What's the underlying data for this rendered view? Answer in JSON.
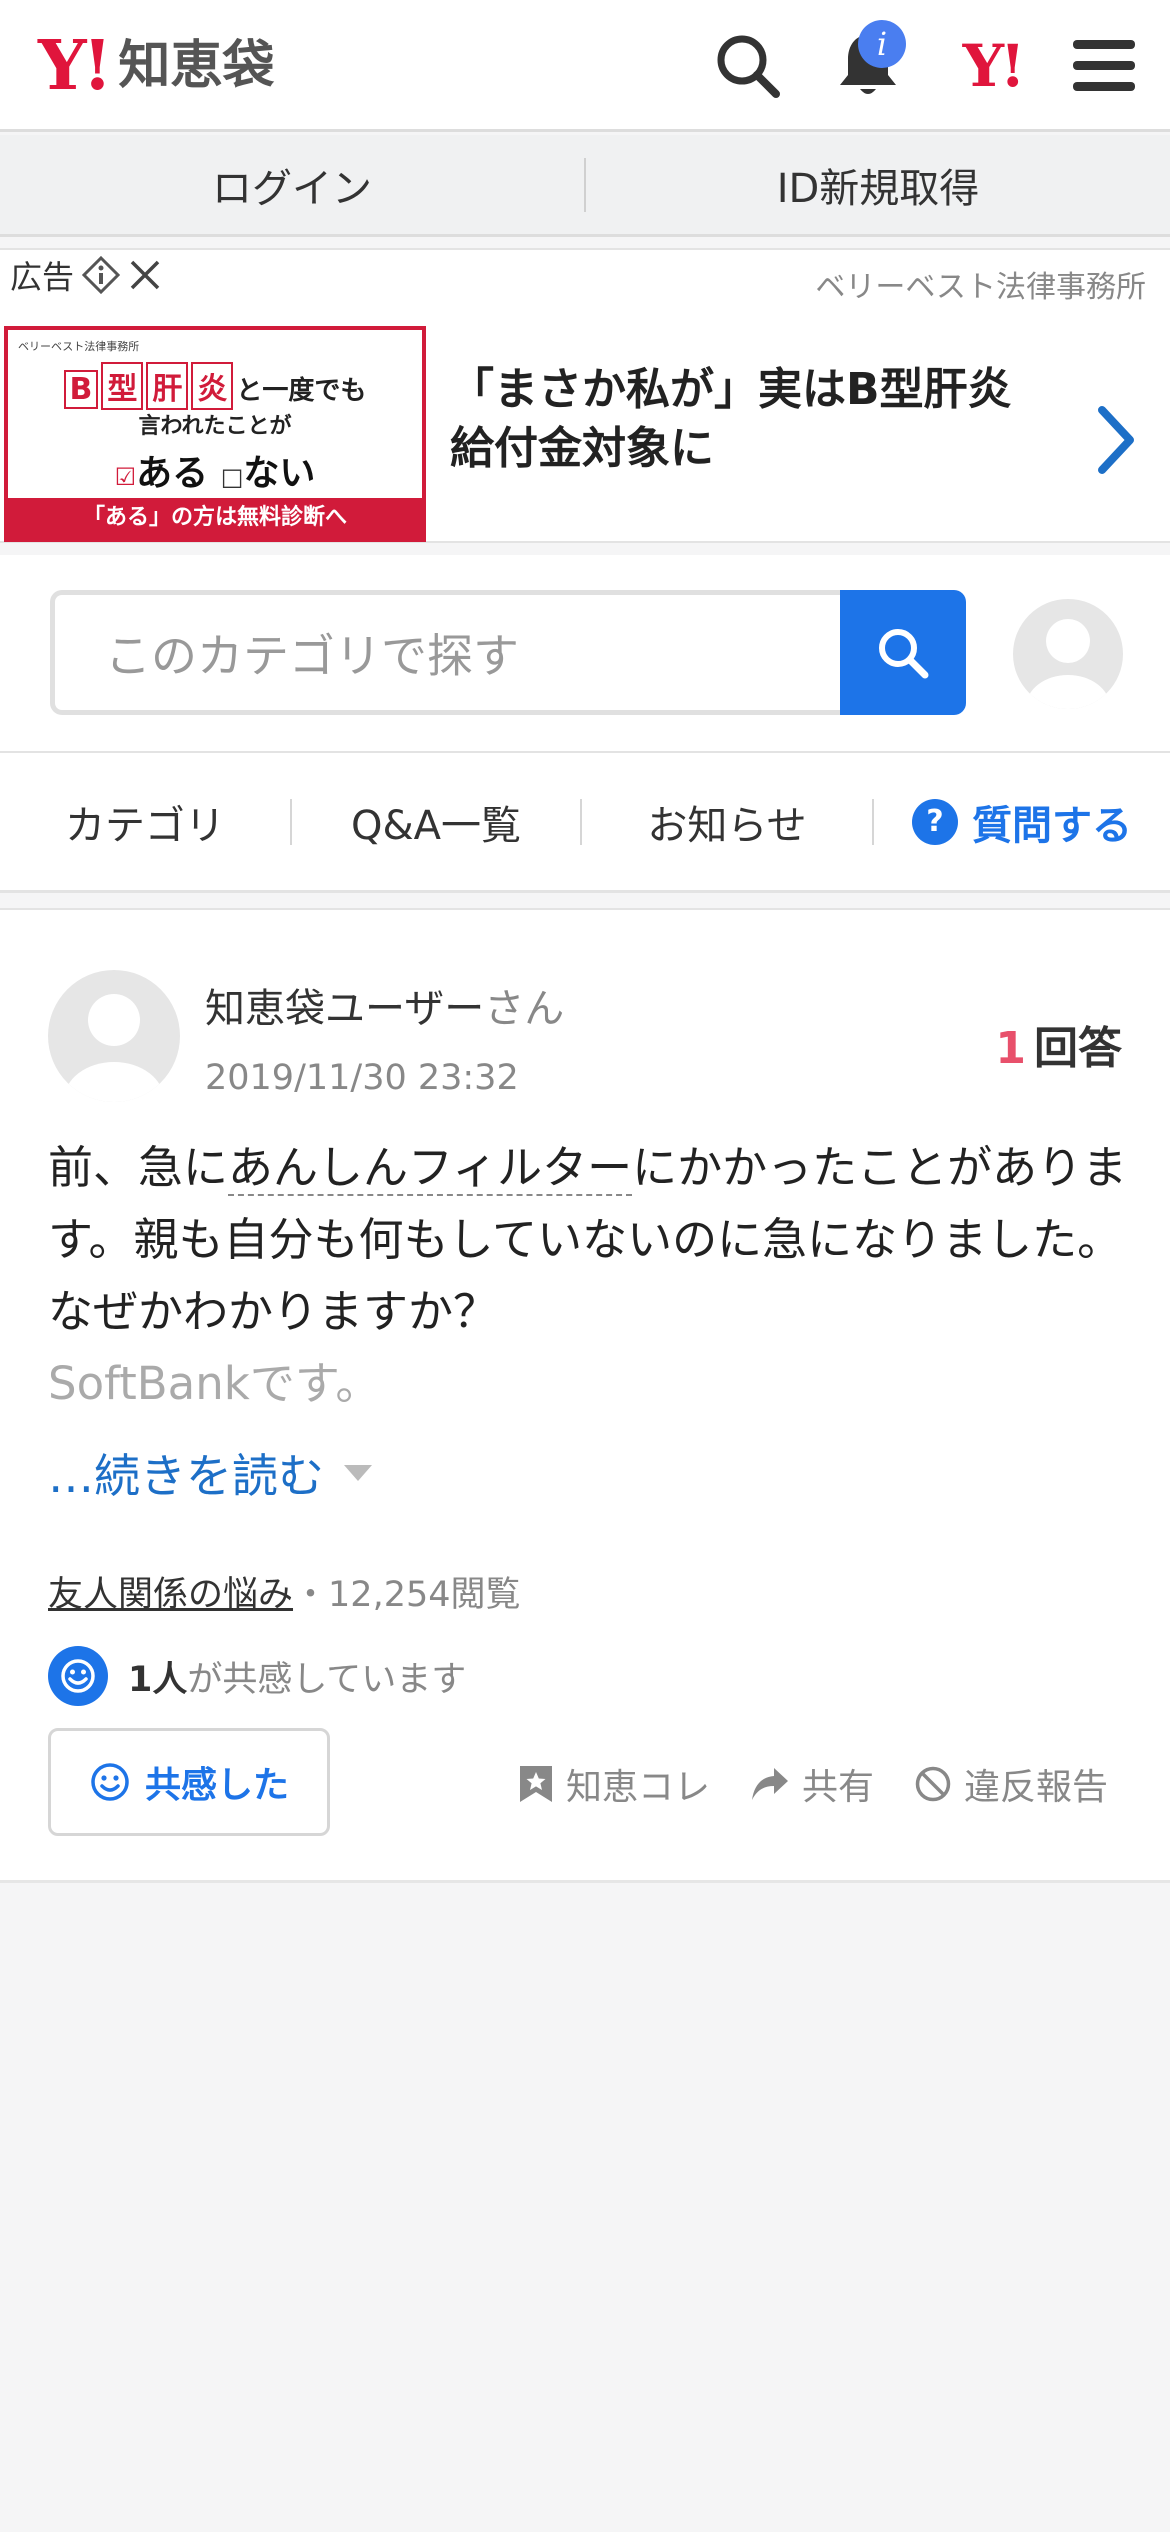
{
  "header": {
    "logo_mark": "Y!",
    "logo_text": "知恵袋",
    "notification_badge": "i",
    "yahoo_mark": "Y!"
  },
  "auth": {
    "login": "ログイン",
    "register": "ID新規取得"
  },
  "ad": {
    "label": "広告",
    "sponsor": "ベリーベスト法律事務所",
    "image": {
      "brand": "ベリーベスト法律事務所",
      "boxed_chars": [
        "B",
        "型",
        "肝",
        "炎"
      ],
      "line1_suffix": "と一度でも",
      "line2": "言われたことが",
      "line3_yes": "ある",
      "line3_no": "ない",
      "bottom": "「ある」の方は無料診断へ"
    },
    "headline": "「まさか私が」実はB型肝炎給付金対象に"
  },
  "search": {
    "placeholder": "このカテゴリで探す"
  },
  "tabs": {
    "category": "カテゴリ",
    "qa_list": "Q&A一覧",
    "news": "お知らせ",
    "ask": "質問する",
    "ask_icon": "?"
  },
  "question": {
    "user": "知恵袋ユーザー",
    "honorific": "さん",
    "date": "2019/11/30 23:32",
    "answer_count": "1",
    "answer_label": "回答",
    "body_pre": "前、急に",
    "body_link": "あんしんフィルター",
    "body_post": "にかかったことがあります。親も自分も何もしていないのに急になりました。なぜかわかりますか？",
    "body_faded": "SoftBankです。",
    "read_more": "…続きを読む",
    "category": "友人関係の悩み",
    "separator": "・",
    "views": "12,254閲覧",
    "empathy_count": "1人",
    "empathy_text": "が共感しています",
    "empathy_button": "共感した",
    "actions": {
      "collection": "知恵コレ",
      "share": "共有",
      "report": "違反報告"
    }
  }
}
